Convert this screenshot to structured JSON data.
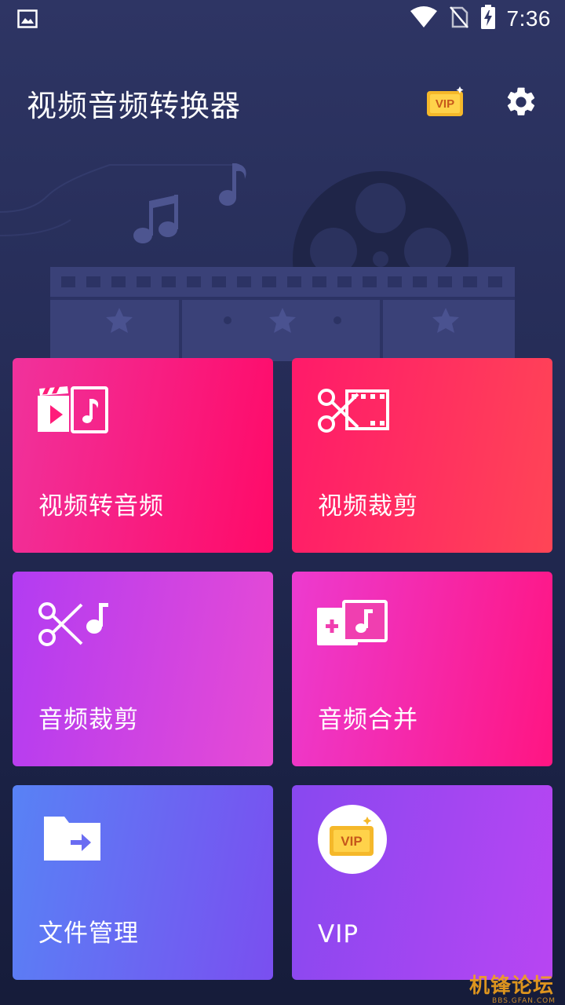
{
  "status_bar": {
    "time": "7:36"
  },
  "header": {
    "title": "视频音频转换器",
    "vip_badge": "VIP"
  },
  "tiles": [
    {
      "label": "视频转音频"
    },
    {
      "label": "视频裁剪"
    },
    {
      "label": "音频裁剪"
    },
    {
      "label": "音频合并"
    },
    {
      "label": "文件管理"
    },
    {
      "label": "VIP",
      "badge": "VIP"
    }
  ],
  "watermark": {
    "text": "机锋论坛",
    "sub": "BBS.GFAN.COM"
  },
  "colors": {
    "bg_top": "#2e3564",
    "bg_bottom": "#161c3a",
    "vip_gold": "#f5b82a",
    "tile_video_to_audio": "#ff0a68",
    "tile_video_crop": "#ff4556",
    "tile_audio_crop": "#b23cf2",
    "tile_audio_merge": "#ff1582",
    "tile_file_manager": "#5882f5",
    "tile_vip": "#b845f2"
  }
}
